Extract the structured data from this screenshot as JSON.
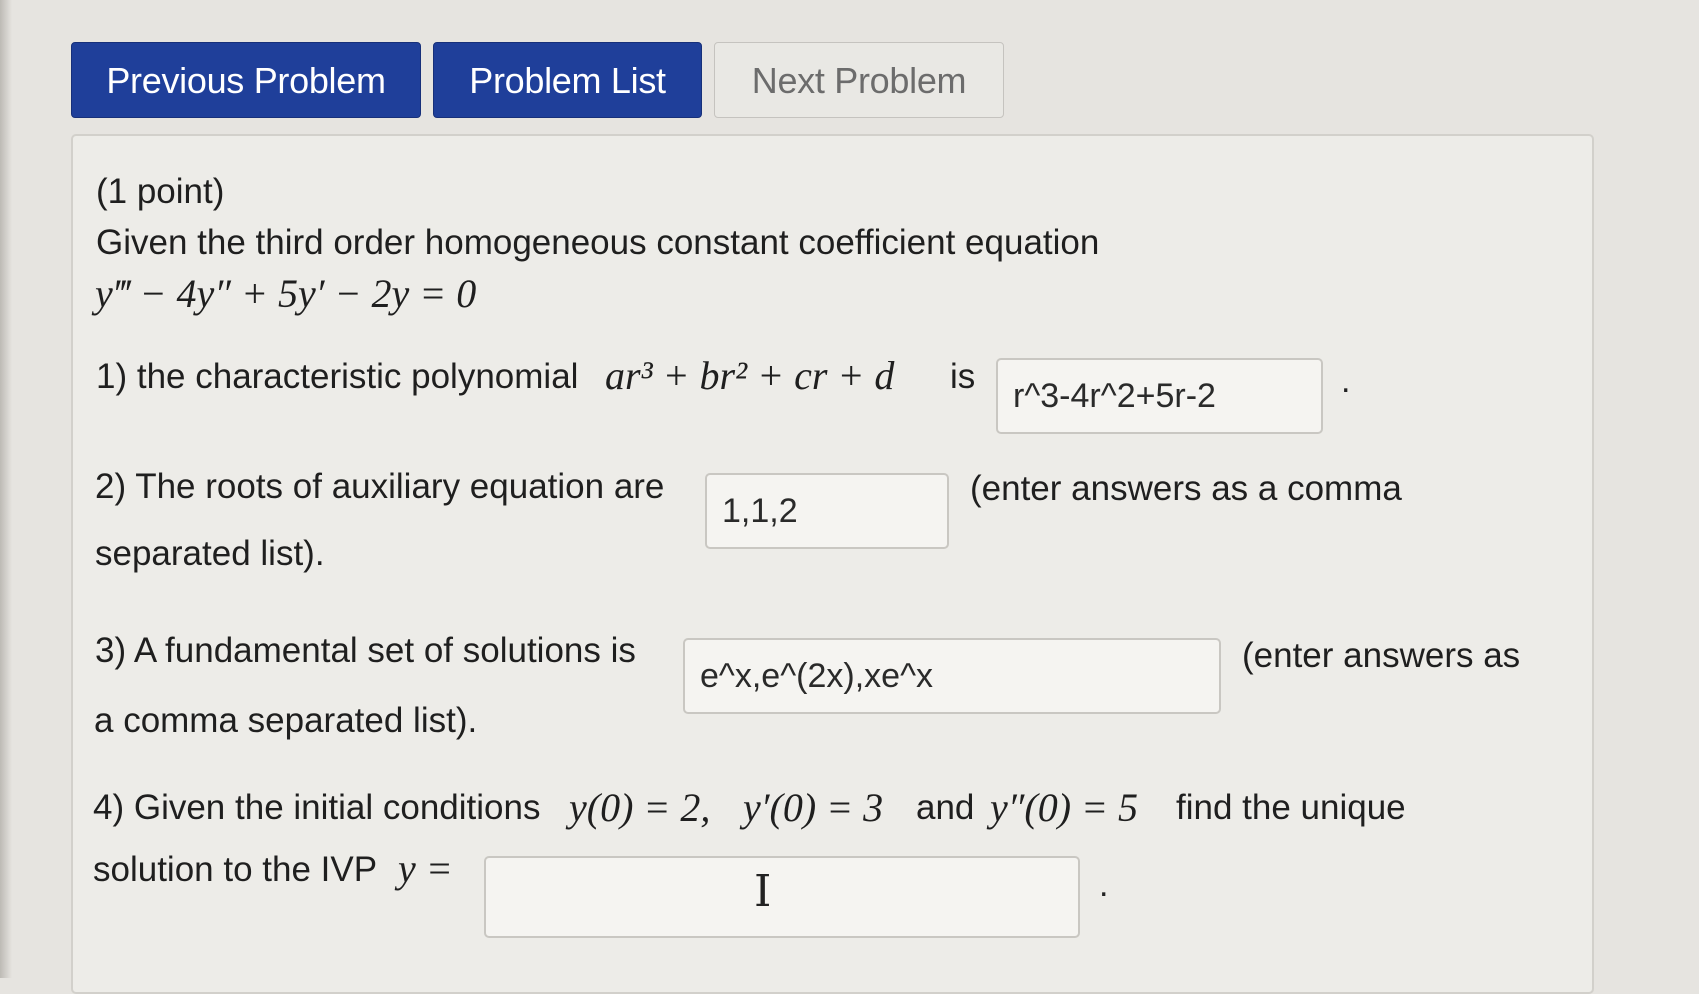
{
  "nav": {
    "previous_label": "Previous Problem",
    "list_label": "Problem List",
    "next_label": "Next Problem"
  },
  "problem": {
    "points": "(1 point)",
    "intro": "Given the third order homogeneous constant coefficient equation",
    "equation": "y‴ − 4y″ + 5y′ − 2y = 0",
    "q1": {
      "prefix": "1) the characteristic polynomial",
      "poly": "ar³ + br² + cr + d",
      "suffix": "is",
      "answer": "r^3-4r^2+5r-2",
      "trailing": "."
    },
    "q2": {
      "prefix": "2) The roots of auxiliary equation are",
      "answer": "1,1,2",
      "suffix_line1": "(enter answers as a comma",
      "suffix_line2": "separated list)."
    },
    "q3": {
      "prefix": "3) A fundamental set of solutions is",
      "answer": "e^x,e^(2x),xe^x",
      "suffix_line1": "(enter answers as",
      "suffix_line2": "a comma separated list)."
    },
    "q4": {
      "text_a": "4) Given the initial conditions",
      "cond1": "y(0) = 2,",
      "cond2": "y′(0) = 3",
      "text_b": "and",
      "cond3": "y″(0) = 5",
      "text_c": "find the unique",
      "text_line2": "solution to the IVP",
      "y_eq": "y =",
      "answer": "",
      "trailing": "."
    }
  }
}
